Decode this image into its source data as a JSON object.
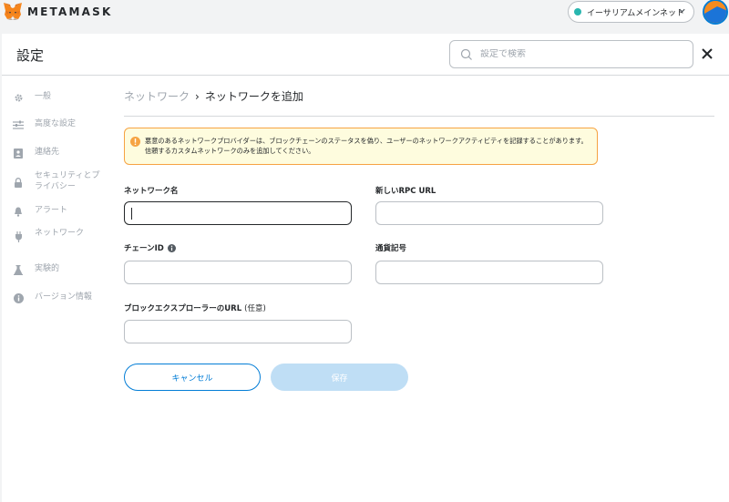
{
  "app": {
    "brand": "METAMASK"
  },
  "network": {
    "label": "イーサリアムメインネット",
    "dot_color": "#29b6af"
  },
  "header": {
    "title": "設定",
    "search_placeholder": "設定で検索"
  },
  "sidebar": {
    "items": [
      {
        "label": "一般",
        "icon": "gear-icon"
      },
      {
        "label": "高度な設定",
        "icon": "sliders-icon"
      },
      {
        "label": "連絡先",
        "icon": "contact-book-icon"
      },
      {
        "label": "セキュリティとプライバシー",
        "icon": "lock-icon"
      },
      {
        "label": "アラート",
        "icon": "bell-icon"
      },
      {
        "label": "ネットワーク",
        "icon": "plug-icon"
      },
      {
        "label": "実験的",
        "icon": "flask-icon"
      },
      {
        "label": "バージョン情報",
        "icon": "info-icon"
      }
    ]
  },
  "breadcrumb": {
    "parent": "ネットワーク",
    "separator": "›",
    "current": "ネットワークを追加"
  },
  "warning": {
    "text": "悪意のあるネットワークプロバイダーは、ブロックチェーンのステータスを偽り、ユーザーのネットワークアクティビティを記録することがあります。信頼するカスタムネットワークのみを追加してください。"
  },
  "form": {
    "network_name": {
      "label": "ネットワーク名",
      "value": ""
    },
    "rpc_url": {
      "label": "新しいRPC URL",
      "value": ""
    },
    "chain_id": {
      "label": "チェーンID",
      "value": ""
    },
    "currency_symbol": {
      "label": "通貨記号",
      "value": ""
    },
    "explorer_url": {
      "label": "ブロックエクスプローラーのURL",
      "optional": "(任意)",
      "value": ""
    }
  },
  "buttons": {
    "cancel": "キャンセル",
    "save": "保存"
  },
  "colors": {
    "accent": "#037dd6",
    "warning_border": "#f6a343",
    "warning_bg": "#fefcde",
    "save_disabled": "#bfdef5"
  }
}
